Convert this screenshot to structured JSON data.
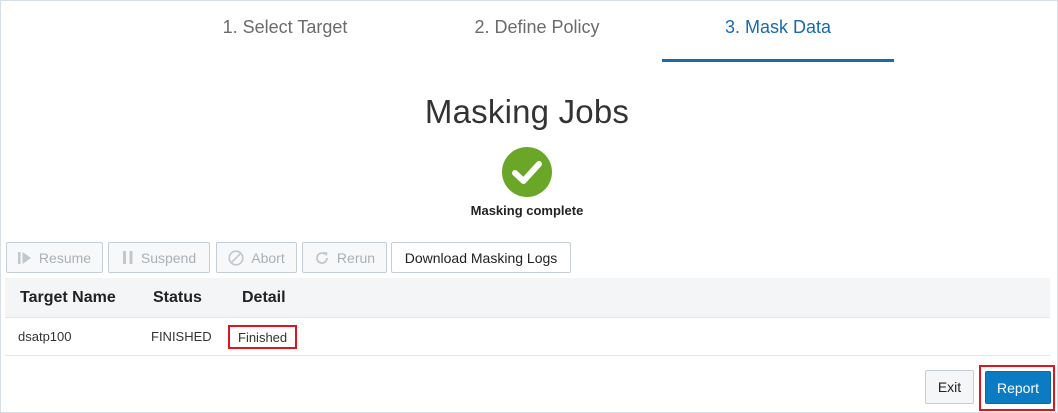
{
  "wizard": {
    "steps": [
      {
        "label": "1. Select Target"
      },
      {
        "label": "2. Define Policy"
      },
      {
        "label": "3. Mask Data",
        "active": true
      }
    ]
  },
  "page": {
    "title": "Masking Jobs",
    "status_icon": "check-circle-icon",
    "status_message": "Masking complete"
  },
  "toolbar": {
    "resume_label": "Resume",
    "suspend_label": "Suspend",
    "abort_label": "Abort",
    "rerun_label": "Rerun",
    "download_logs_label": "Download Masking Logs"
  },
  "table": {
    "columns": [
      "Target Name",
      "Status",
      "Detail"
    ],
    "rows": [
      {
        "target_name": "dsatp100",
        "status": "FINISHED",
        "detail": "Finished"
      }
    ]
  },
  "footer": {
    "exit_label": "Exit",
    "report_label": "Report"
  },
  "colors": {
    "accent": "#1a6aa8",
    "primary_button": "#0b7bc4",
    "success": "#6aa728",
    "highlight": "#e0141e"
  }
}
